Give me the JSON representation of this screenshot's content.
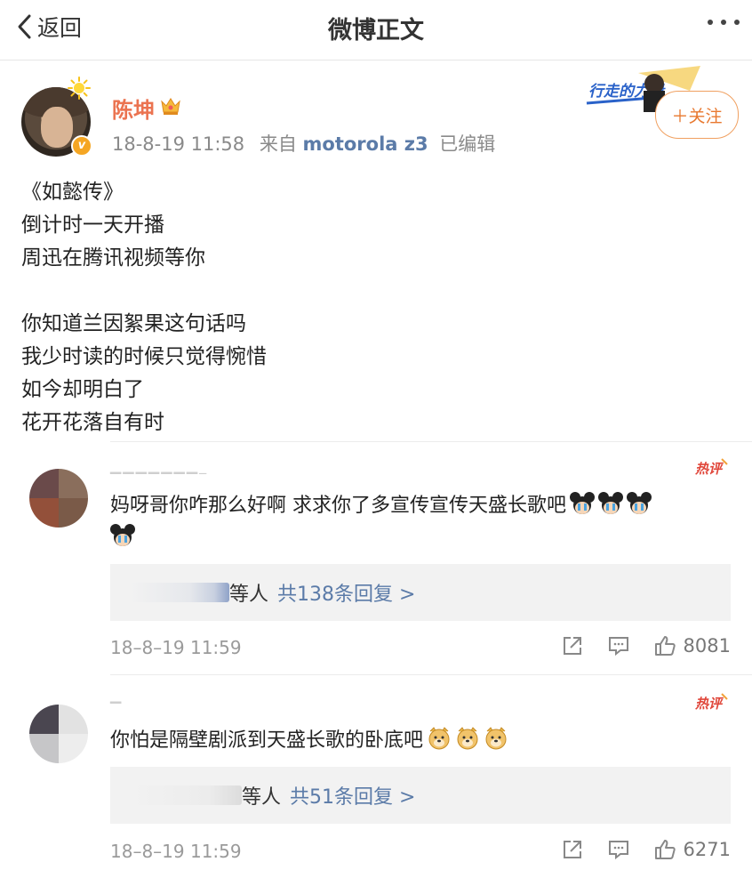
{
  "nav": {
    "back_label": "返回",
    "title": "微博正文"
  },
  "post": {
    "author": "陈坤",
    "time": "18-8-19 11:58",
    "from_prefix": "来自",
    "source": "motorola z3",
    "edited": "已编辑",
    "follow_label": "＋关注",
    "banner_text": "行走的力量",
    "lines": [
      "《如懿传》",
      "倒计时一天开播",
      "周迅在腾讯视频等你",
      "",
      "你知道兰因絮果这句话吗",
      "我少时读的时候只觉得惋惜",
      "如今却明白了",
      "花开花落自有时"
    ]
  },
  "comments": [
    {
      "hot_label": "热评",
      "text": "妈呀哥你咋那么好啊 求求你了多宣传宣传天盛长歌吧",
      "emoji": "mickey-cry",
      "emoji_count_line1": 3,
      "emoji_count_line2": 1,
      "reply_suffix": "等人",
      "reply_link": "共138条回复 >",
      "time": "18–8–19 11:59",
      "likes": "8081"
    },
    {
      "hot_label": "热评",
      "text": "你怕是隔壁剧派到天盛长歌的卧底吧",
      "emoji": "doge",
      "emoji_count_line1": 3,
      "emoji_count_line2": 0,
      "reply_suffix": "等人",
      "reply_link": "共51条回复 >",
      "time": "18–8–19 11:59",
      "likes": "6271"
    }
  ],
  "colors": {
    "author": "#eb7350",
    "link": "#5b7ba8",
    "follow": "#e8782f",
    "hot": "#e0463a"
  }
}
